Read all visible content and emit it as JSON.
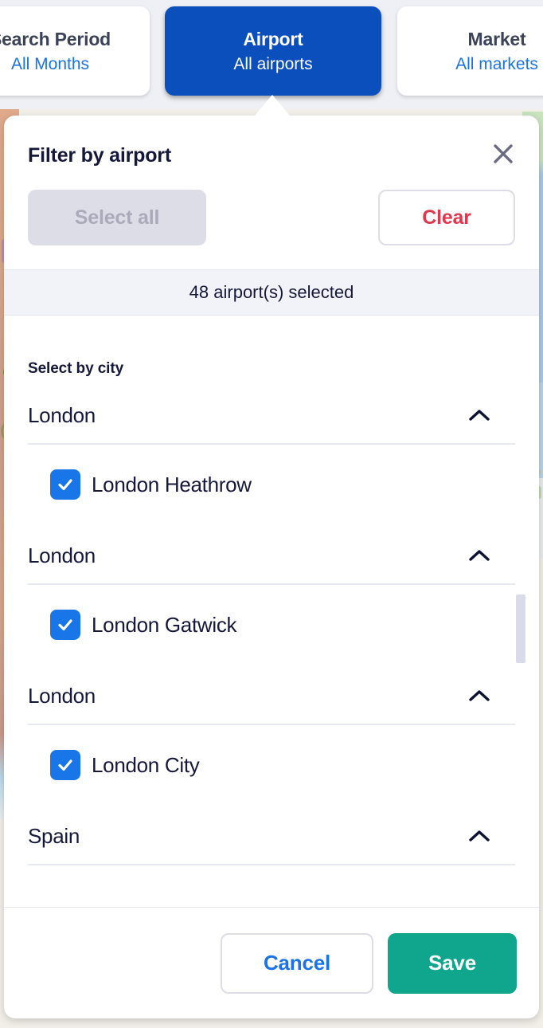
{
  "tabs": [
    {
      "title": "Search Period",
      "value": "All Months",
      "active": false,
      "name": "tab-search-period"
    },
    {
      "title": "Airport",
      "value": "All airports",
      "active": true,
      "name": "tab-airport"
    },
    {
      "title": "Market",
      "value": "All markets",
      "active": false,
      "name": "tab-market"
    }
  ],
  "panel": {
    "title": "Filter by airport",
    "close_icon": "close-icon",
    "select_all_label": "Select all",
    "clear_label": "Clear",
    "count_text": "48 airport(s) selected",
    "select_by_label": "Select by city",
    "groups": [
      {
        "city": "London",
        "expanded": true,
        "chevron_icon": "chevron-up-icon",
        "airports": [
          {
            "name": "London Heathrow",
            "checked": true
          }
        ]
      },
      {
        "city": "London",
        "expanded": true,
        "chevron_icon": "chevron-up-icon",
        "airports": [
          {
            "name": "London Gatwick",
            "checked": true
          }
        ]
      },
      {
        "city": "London",
        "expanded": true,
        "chevron_icon": "chevron-up-icon",
        "airports": [
          {
            "name": "London City",
            "checked": true
          }
        ]
      },
      {
        "city": "Spain",
        "expanded": true,
        "chevron_icon": "chevron-up-icon",
        "airports": []
      }
    ],
    "cancel_label": "Cancel",
    "save_label": "Save"
  },
  "colors": {
    "active_tab_blue": "#0b4fbd",
    "link_blue": "#1a73e8",
    "checkbox_blue": "#1876e8",
    "clear_red": "#e0374f",
    "save_teal": "#0fa68d",
    "text_dark": "#16183a",
    "tabbar_grey": "#eef0f5",
    "count_bar_grey": "#f1f3f8",
    "disabled_grey": "#dcdde6"
  }
}
